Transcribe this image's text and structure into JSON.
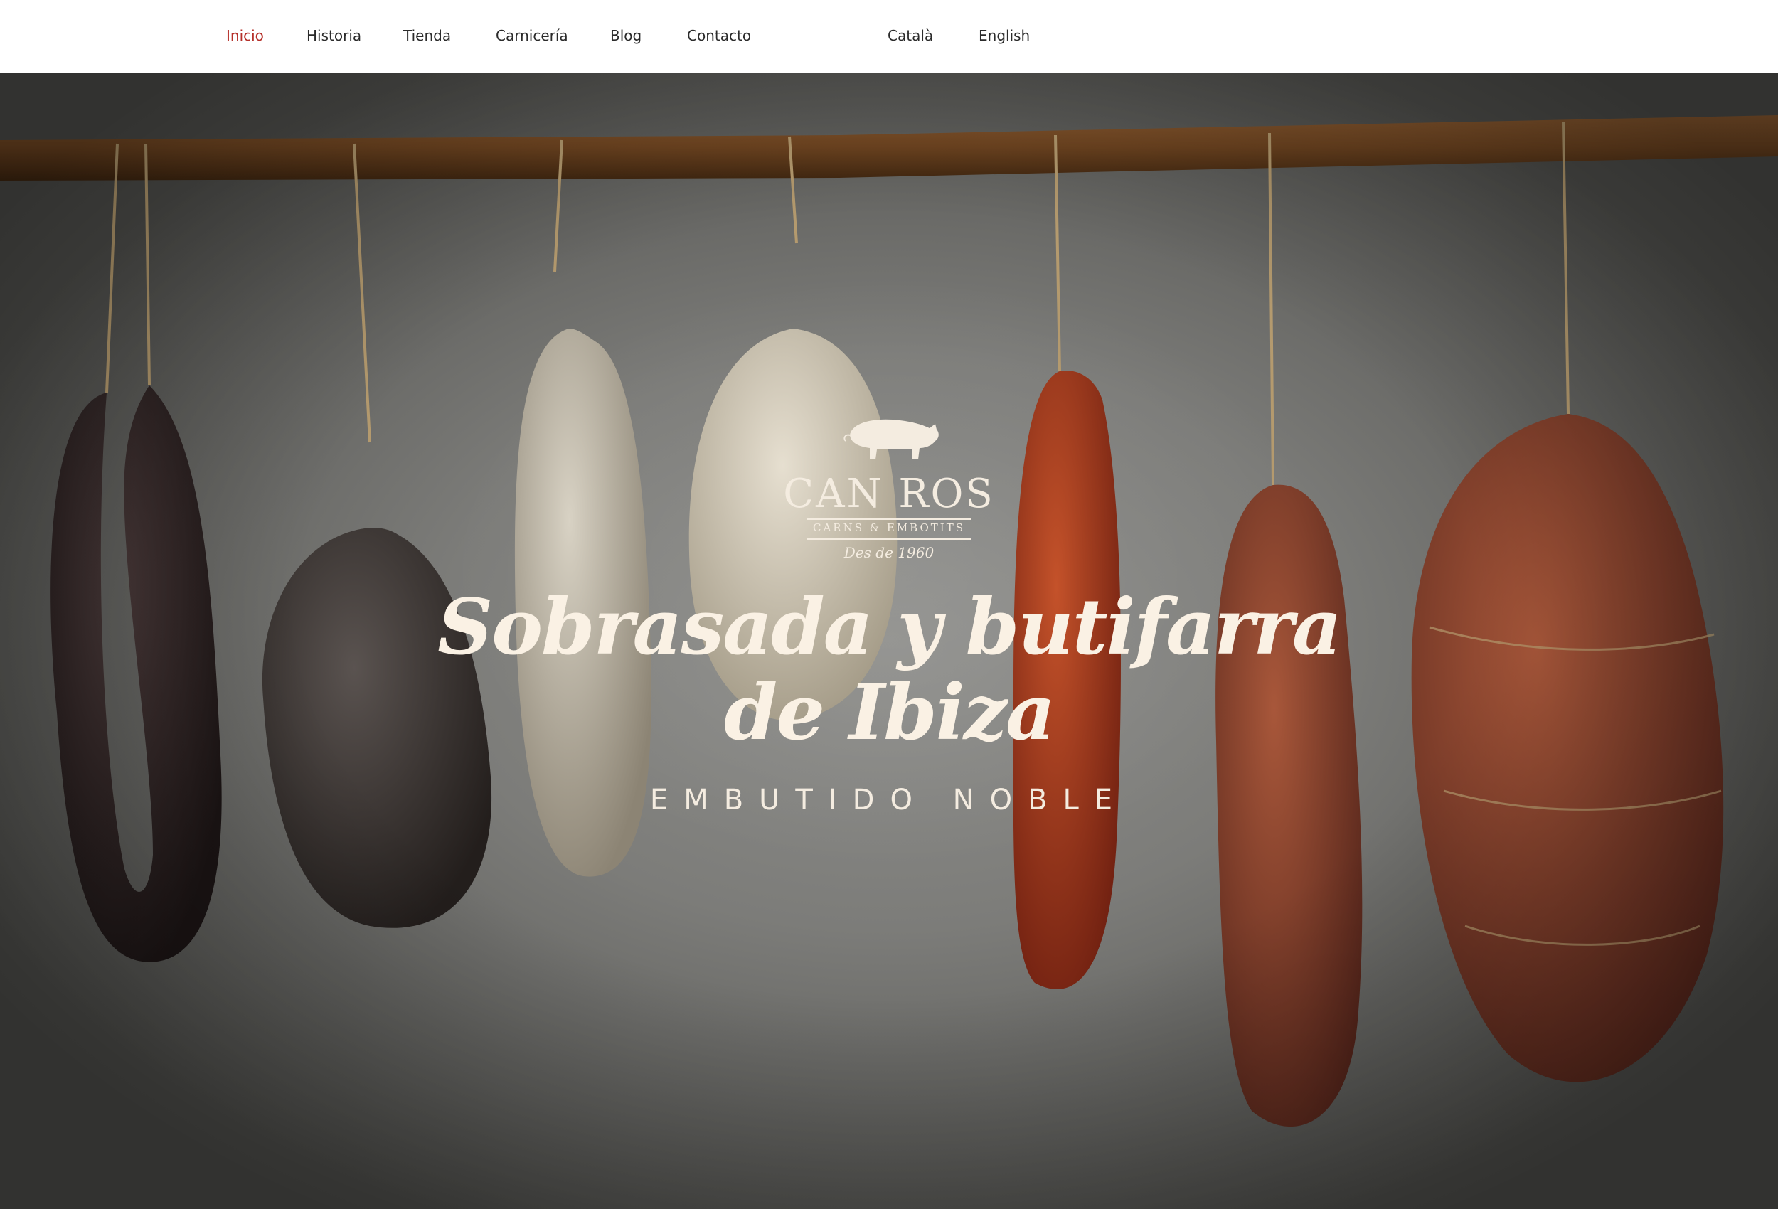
{
  "nav": {
    "items": [
      {
        "label": "Inicio",
        "active": true
      },
      {
        "label": "Historia",
        "active": false
      },
      {
        "label": "Tienda",
        "active": false
      },
      {
        "label": "Carnicería",
        "active": false
      },
      {
        "label": "Blog",
        "active": false
      },
      {
        "label": "Contacto",
        "active": false
      }
    ],
    "languages": [
      {
        "label": "Català"
      },
      {
        "label": "English"
      }
    ]
  },
  "brand": {
    "icon": "pig-icon",
    "name": "CAN ROS",
    "subtitle": "CARNS & EMBOTITS",
    "since": "Des de 1960"
  },
  "hero": {
    "headline_line1": "Sobrasada y butifarra",
    "headline_line2": "de Ibiza",
    "tagline": "EMBUTIDO NOBLE"
  },
  "colors": {
    "accent": "#b5302a",
    "nav_text": "#2b2b2b",
    "hero_text": "#faf1e4"
  }
}
